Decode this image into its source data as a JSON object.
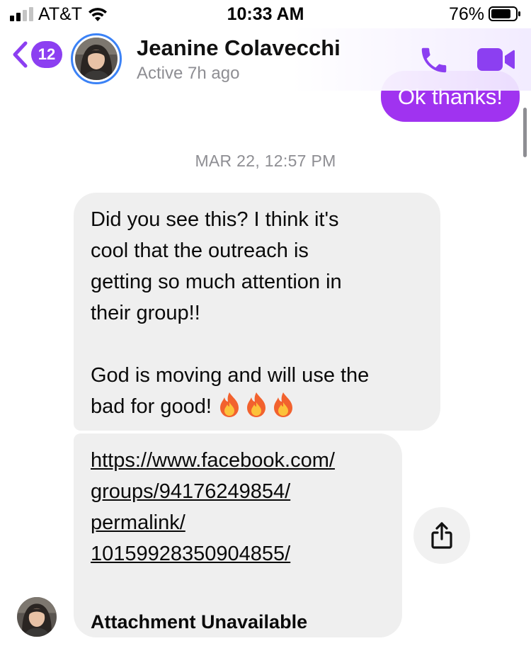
{
  "status_bar": {
    "carrier": "AT&T",
    "time": "10:33 AM",
    "battery_percent": "76%"
  },
  "header": {
    "back_badge_count": "12",
    "contact_name": "Jeanine Colavecchi",
    "contact_status": "Active 7h ago",
    "accent_color": "#8c3ff1"
  },
  "conversation": {
    "outgoing_message": "Ok thanks!",
    "timestamp": "MAR 22, 12:57 PM",
    "message_1": {
      "line_1": "Did you see this? I think it's",
      "line_2": "cool that the outreach is",
      "line_3": "getting so much attention in",
      "line_4": "their group!!",
      "line_5": "God is moving and will use the",
      "line_6": "bad for good!",
      "emoji": "fire-icon x3"
    },
    "message_2": {
      "link_line_1": "https://www.facebook.com/",
      "link_line_2": "groups/94176249854/",
      "link_line_3": "permalink/",
      "link_line_4": "10159928350904855/",
      "attachment_label": "Attachment Unavailable"
    }
  },
  "icons": {
    "back": "chevron-left-icon",
    "call": "phone-icon",
    "video": "video-camera-icon",
    "share": "share-icon"
  }
}
